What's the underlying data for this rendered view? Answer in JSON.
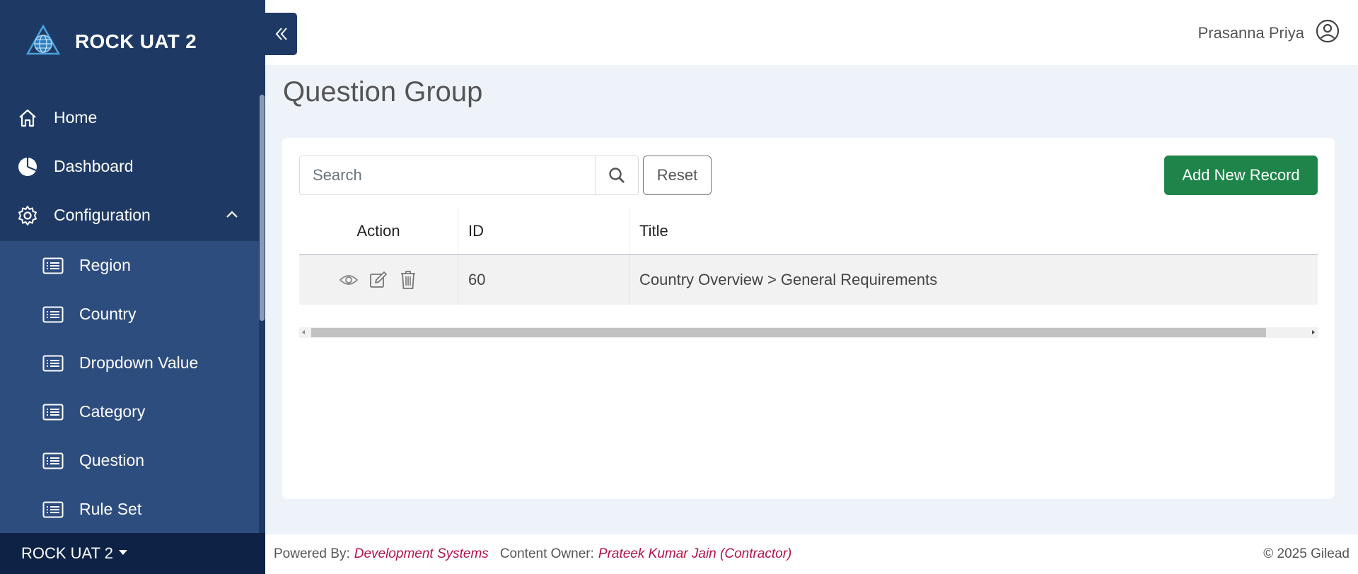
{
  "app": {
    "brand_name": "ROCK UAT 2",
    "env_label": "ROCK UAT 2"
  },
  "sidebar": {
    "items": [
      {
        "label": "Home",
        "icon": "home-icon"
      },
      {
        "label": "Dashboard",
        "icon": "pie-chart-icon"
      },
      {
        "label": "Configuration",
        "icon": "gear-icon",
        "expanded": true
      }
    ],
    "submenu": [
      {
        "label": "Region",
        "icon": "list-icon"
      },
      {
        "label": "Country",
        "icon": "list-icon"
      },
      {
        "label": "Dropdown Value",
        "icon": "list-icon"
      },
      {
        "label": "Category",
        "icon": "list-icon"
      },
      {
        "label": "Question",
        "icon": "list-icon"
      },
      {
        "label": "Rule Set",
        "icon": "list-icon"
      }
    ]
  },
  "header": {
    "user_name": "Prasanna Priya"
  },
  "page": {
    "title": "Question Group"
  },
  "toolbar": {
    "search_placeholder": "Search",
    "reset_label": "Reset",
    "add_label": "Add New Record"
  },
  "table": {
    "columns": [
      "Action",
      "ID",
      "Title"
    ],
    "rows": [
      {
        "id": "60",
        "title": "Country Overview > General Requirements"
      }
    ]
  },
  "footer": {
    "powered_label": "Powered By:",
    "powered_value": "Development Systems",
    "owner_label": "Content Owner:",
    "owner_value": "Prateek Kumar Jain (Contractor)",
    "copyright": "© 2025 Gilead"
  },
  "colors": {
    "sidebar_bg": "#1e3a64",
    "submenu_bg": "#2d4d7e",
    "env_bar_bg": "#0e2246",
    "primary_green": "#1e8449",
    "footer_accent": "#b0124b"
  }
}
